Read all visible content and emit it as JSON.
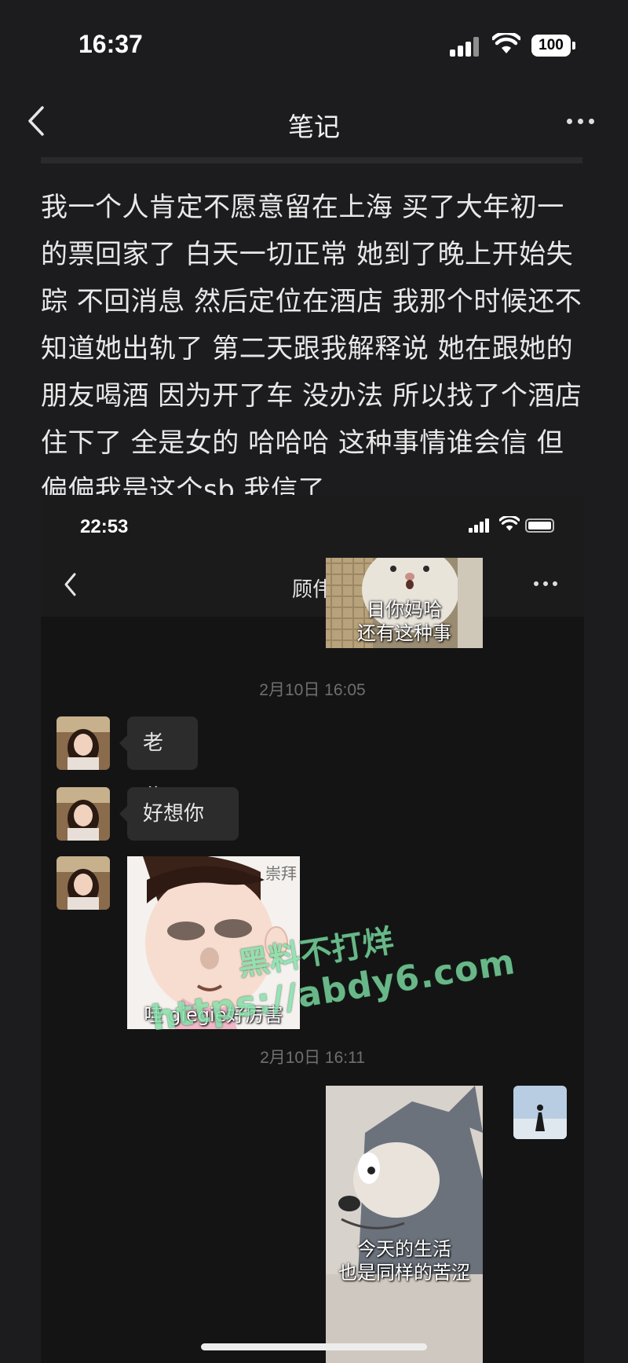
{
  "status_bar": {
    "time": "16:37",
    "battery": "100"
  },
  "nav": {
    "title": "笔记"
  },
  "note": {
    "text": "我一个人肯定不愿意留在上海 买了大年初一的票回家了 白天一切正常 她到了晚上开始失踪 不回消息 然后定位在酒店 我那个时候还不知道她出轨了 第二天跟我解释说 她在跟她的朋友喝酒 因为开了车 没办法 所以找了个酒店 住下了 全是女的 哈哈哈 这种事情谁会信 但偏偏我是这个sb 我信了"
  },
  "chat": {
    "status_time": "22:53",
    "title": "顾伟",
    "sticker1_caption": [
      "日你妈哈",
      "还有这种事"
    ],
    "timestamp1": "2月10日 16:05",
    "messages": [
      {
        "text": "老公"
      },
      {
        "text": "好想你呀"
      }
    ],
    "sticker2_caption": "哇 giegie好厉害",
    "sticker2_corner": "崇拜",
    "timestamp2": "2月10日 16:11",
    "sticker3_caption": [
      "今天的生活",
      "也是同样的苦涩"
    ]
  },
  "watermark": {
    "line1": "黑料不打烊",
    "line2": "https://abdy6.com"
  },
  "colors": {
    "background": "#1c1c1e",
    "bubble": "#2c2c2c",
    "watermark": "#7fe0a6"
  },
  "icons": [
    "cellular-signal-icon",
    "wifi-icon",
    "battery-icon",
    "back-chevron-icon",
    "more-options-icon"
  ]
}
